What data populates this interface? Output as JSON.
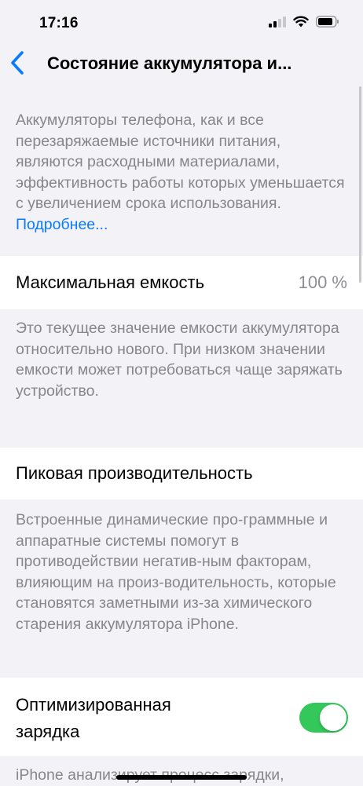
{
  "status_bar": {
    "time": "17:16"
  },
  "nav": {
    "title": "Состояние аккумулятора и..."
  },
  "intro": {
    "text": "Аккумуляторы телефона, как и все перезаряжаемые источники питания, являются расходными материалами, эффективность работы которых уменьшается с увеличением срока использования.",
    "link": "Подробнее..."
  },
  "max_capacity": {
    "label": "Максимальная емкость",
    "value": "100 %",
    "footnote": "Это текущее значение емкости аккумулятора относительно нового. При низком значении емкости может потребоваться чаще заряжать устройство."
  },
  "peak_performance": {
    "label": "Пиковая производительность",
    "footnote": "Встроенные динамические про-граммные и аппаратные системы помогут в противодействии негатив-ным факторам, влияющим на произ-водительность, которые становятся заметными из-за химического старения аккумулятора iPhone."
  },
  "optimized_charging": {
    "label": "Оптимизированная зарядка",
    "enabled": true,
    "footnote": "iPhone анализирует процесс зарядки,"
  },
  "colors": {
    "accent": "#0a7aff",
    "toggle_on": "#34c759",
    "background": "#f2f2f7",
    "secondary_text": "#86868b"
  }
}
